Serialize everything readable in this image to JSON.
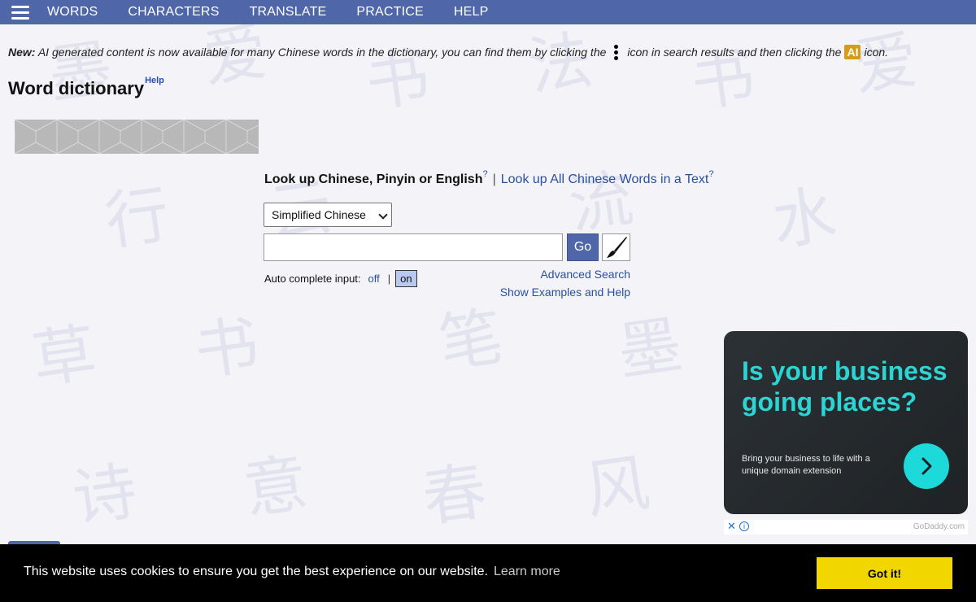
{
  "nav": {
    "menu_icon": "hamburger-icon",
    "items": [
      "WORDS",
      "CHARACTERS",
      "TRANSLATE",
      "PRACTICE",
      "HELP"
    ]
  },
  "notice": {
    "label": "New:",
    "text_before": "AI generated content is now available for many Chinese words in the dictionary, you can find them by clicking the",
    "text_middle": "icon in search results and then clicking the",
    "ai_badge": "AI",
    "text_after": "icon."
  },
  "page": {
    "title": "Word dictionary",
    "title_help": "Help"
  },
  "lookup": {
    "label": "Look up Chinese, Pinyin or English",
    "label_help": "?",
    "separator": "|",
    "text_link": "Look up All Chinese Words in a Text",
    "text_link_help": "?"
  },
  "search": {
    "script_selected": "Simplified Chinese",
    "input_value": "",
    "go_label": "Go",
    "handwriting_icon": "brush-icon"
  },
  "autocomplete": {
    "label": "Auto complete input:",
    "off_label": "off",
    "separator": "|",
    "on_label": "on",
    "selected": "on"
  },
  "links": {
    "advanced_search": "Advanced Search",
    "examples_help": "Show Examples and Help"
  },
  "ad": {
    "headline": "Is your business going places?",
    "subtext": "Bring your business to life with a unique domain extension",
    "brand": "GoDaddy.com",
    "close": "✕",
    "info": "i",
    "accent_color": "#1ed9d9"
  },
  "cookie": {
    "message": "This website uses cookies to ensure you get the best experience on our website.",
    "learn_more": "Learn more",
    "accept_label": "Got it!"
  },
  "colors": {
    "nav_bg": "#4f67a8",
    "link": "#2a4fa0",
    "cookie_button": "#f1d600"
  }
}
